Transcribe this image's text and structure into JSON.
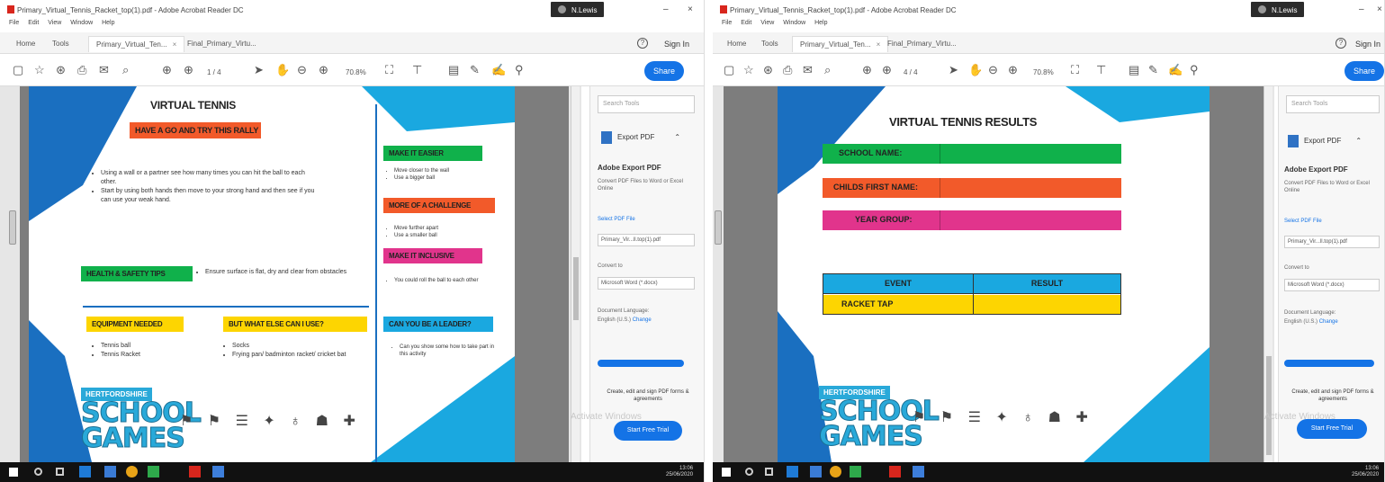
{
  "colors": {
    "green": "#10b14b",
    "orange": "#f25a2a",
    "pink": "#e1348c",
    "yellow": "#fdd501",
    "blue": "#1aa8e0",
    "dark_blue": "#1a6fc0",
    "adobe_blue": "#1473e6"
  },
  "left": {
    "window_title": "Primary_Virtual_Tennis_Racket_top(1).pdf - Adobe Acrobat Reader DC",
    "user": "N.Lewis",
    "menu": [
      "File",
      "Edit",
      "View",
      "Window",
      "Help"
    ],
    "tabs": [
      "Home",
      "Tools",
      "Primary_Virtual_Ten...",
      "Final_Primary_Virtu..."
    ],
    "sign_in": "Sign In",
    "page_nav": "1 / 4",
    "zoom": "70.8%",
    "share": "Share",
    "doc": {
      "title": "VIRTUAL TENNIS",
      "subtitle": "HAVE A GO AND TRY THIS RALLY",
      "bullets": [
        "Using a wall or a partner see how many times you can hit the ball to each other.",
        "Start by using both hands then move to your strong hand and then see if you can use your weak hand."
      ],
      "health_label": "HEALTH & SAFETY TIPS",
      "health_text": "Ensure surface is flat, dry and clear from obstacles",
      "equipment_label": "EQUIPMENT NEEDED",
      "equipment_items": [
        "Tennis ball",
        "Tennis Racket"
      ],
      "else_label": "BUT WHAT ELSE CAN I USE?",
      "else_items": [
        "Socks",
        "Frying pan/ badminton racket/ cricket bat"
      ],
      "easier_label": "MAKE IT EASIER",
      "easier_items": [
        "Move closer to the wall",
        "Use a bigger ball"
      ],
      "challenge_label": "MORE OF A CHALLENGE",
      "challenge_items": [
        "Move further apart",
        "Use a smaller ball"
      ],
      "inclusive_label": "MAKE IT INCLUSIVE",
      "inclusive_items": [
        "You could roll the ball to each other"
      ],
      "leader_label": "CAN YOU BE A LEADER?",
      "leader_items": [
        "Can you show some how to take part in this activity"
      ],
      "herts": "HERTFORDSHIRE",
      "school": "SCHOOL",
      "games": "GAMES"
    },
    "panel": {
      "search": "Search Tools",
      "export": "Export PDF",
      "export_head": "Adobe Export PDF",
      "export_desc": "Convert PDF Files to Word or Excel Online",
      "select": "Select PDF File",
      "file": "Primary_Vir...ll.top(1).pdf",
      "convert_to": "Convert to",
      "format": "Microsoft Word (*.docx)",
      "lang_label": "Document Language:",
      "lang": "English (U.S.)",
      "change": "Change",
      "create_text": "Create, edit and sign PDF forms & agreements",
      "trial": "Start Free Trial",
      "watermark": "Activate Windows"
    },
    "clock": [
      "13:06",
      "25/06/2020"
    ]
  },
  "right": {
    "window_title": "Primary_Virtual_Tennis_Racket_top(1).pdf - Adobe Acrobat Reader DC",
    "user": "N.Lewis",
    "menu": [
      "File",
      "Edit",
      "View",
      "Window",
      "Help"
    ],
    "tabs": [
      "Home",
      "Tools",
      "Primary_Virtual_Ten...",
      "Final_Primary_Virtu..."
    ],
    "sign_in": "Sign In",
    "page_nav": "4 / 4",
    "zoom": "70.8%",
    "share": "Share",
    "doc": {
      "title": "VIRTUAL TENNIS RESULTS",
      "row1": "SCHOOL NAME:",
      "row2": "CHILDS FIRST NAME:",
      "row3": "YEAR GROUP:",
      "col1": "EVENT",
      "col2": "RESULT",
      "cell1": "RACKET TAP",
      "herts": "HERTFORDSHIRE",
      "school": "SCHOOL",
      "games": "GAMES"
    },
    "panel": {
      "search": "Search Tools",
      "export": "Export PDF",
      "export_head": "Adobe Export PDF",
      "export_desc": "Convert PDF Files to Word or Excel Online",
      "select": "Select PDF File",
      "file": "Primary_Vir...ll.top(1).pdf",
      "convert_to": "Convert to",
      "format": "Microsoft Word (*.docx)",
      "lang_label": "Document Language:",
      "lang": "English (U.S.)",
      "change": "Change",
      "create_text": "Create, edit and sign PDF forms & agreements",
      "trial": "Start Free Trial",
      "watermark": "Activate Windows"
    },
    "clock": [
      "13:06",
      "25/06/2020"
    ]
  }
}
